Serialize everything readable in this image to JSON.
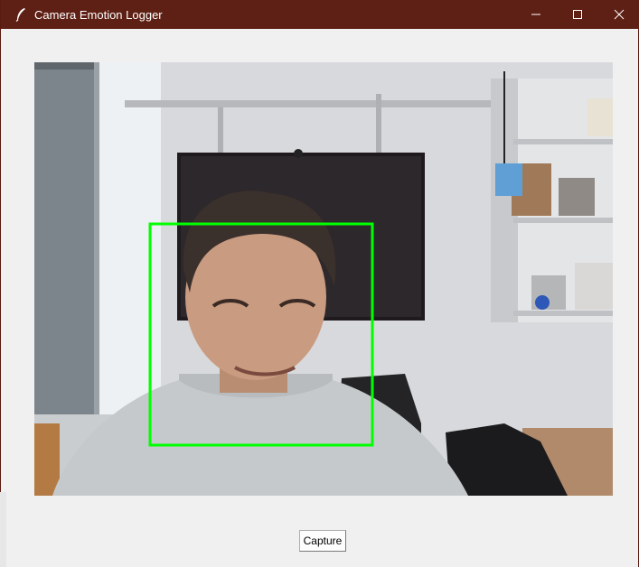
{
  "window": {
    "title": "Camera Emotion Logger",
    "titlebar_color": "#5e1f14",
    "controls": {
      "minimize_icon": "minimize-icon",
      "maximize_icon": "maximize-icon",
      "close_icon": "close-icon"
    }
  },
  "video": {
    "face_box_color": "#00ff00"
  },
  "toolbar": {
    "capture_label": "Capture"
  }
}
